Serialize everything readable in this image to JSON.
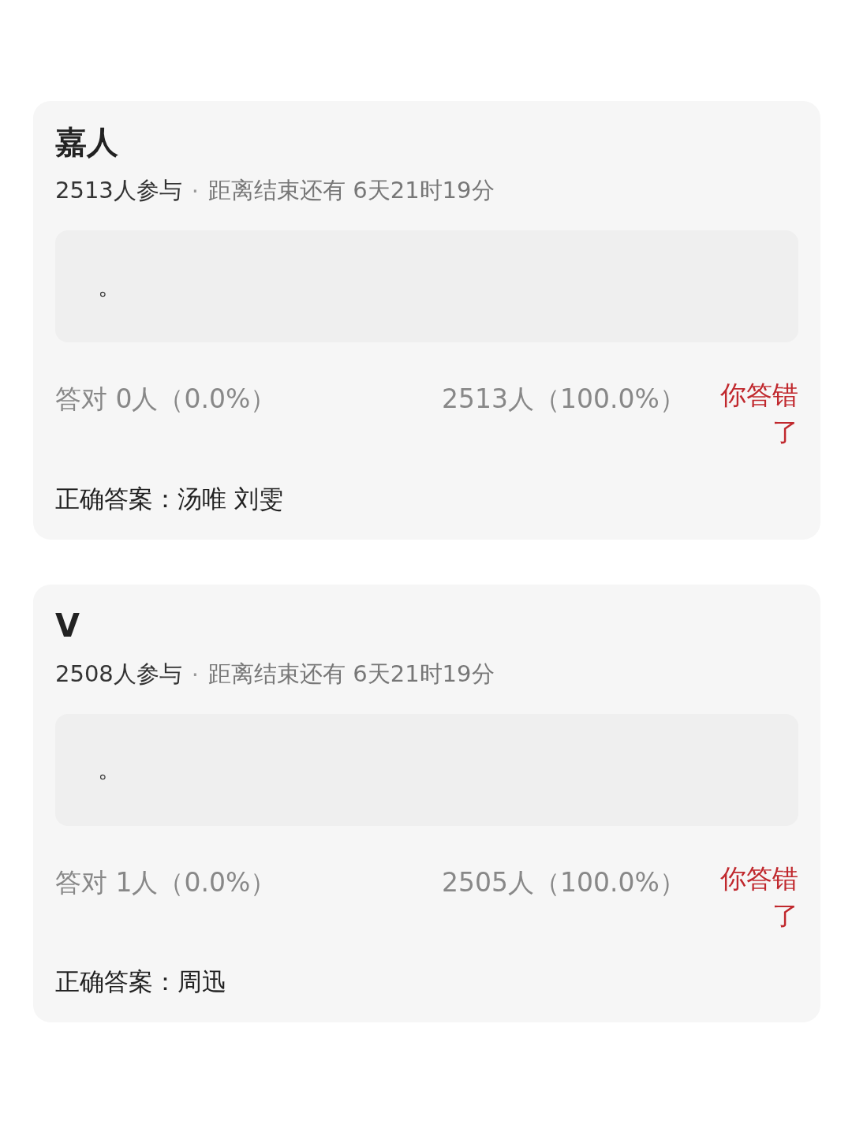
{
  "cards": [
    {
      "title": "嘉人",
      "participants": "2513人参与",
      "separator": "·",
      "countdown": "距离结束还有 6天21时19分",
      "answer": "。",
      "correct_count": "答对  0人（0.0%）",
      "wrong_count": "2513人（100.0%）",
      "result": {
        "kind": "wrong",
        "text": "你答错了"
      },
      "correct_answer": "正确答案：汤唯 刘雯"
    },
    {
      "title": "V",
      "participants": "2508人参与",
      "separator": "·",
      "countdown": "距离结束还有 6天21时19分",
      "answer": "。",
      "correct_count": "答对  1人（0.0%）",
      "wrong_count": "2505人（100.0%）",
      "result": {
        "kind": "wrong",
        "text": "你答错了"
      },
      "correct_answer": "正确答案：周迅"
    }
  ]
}
